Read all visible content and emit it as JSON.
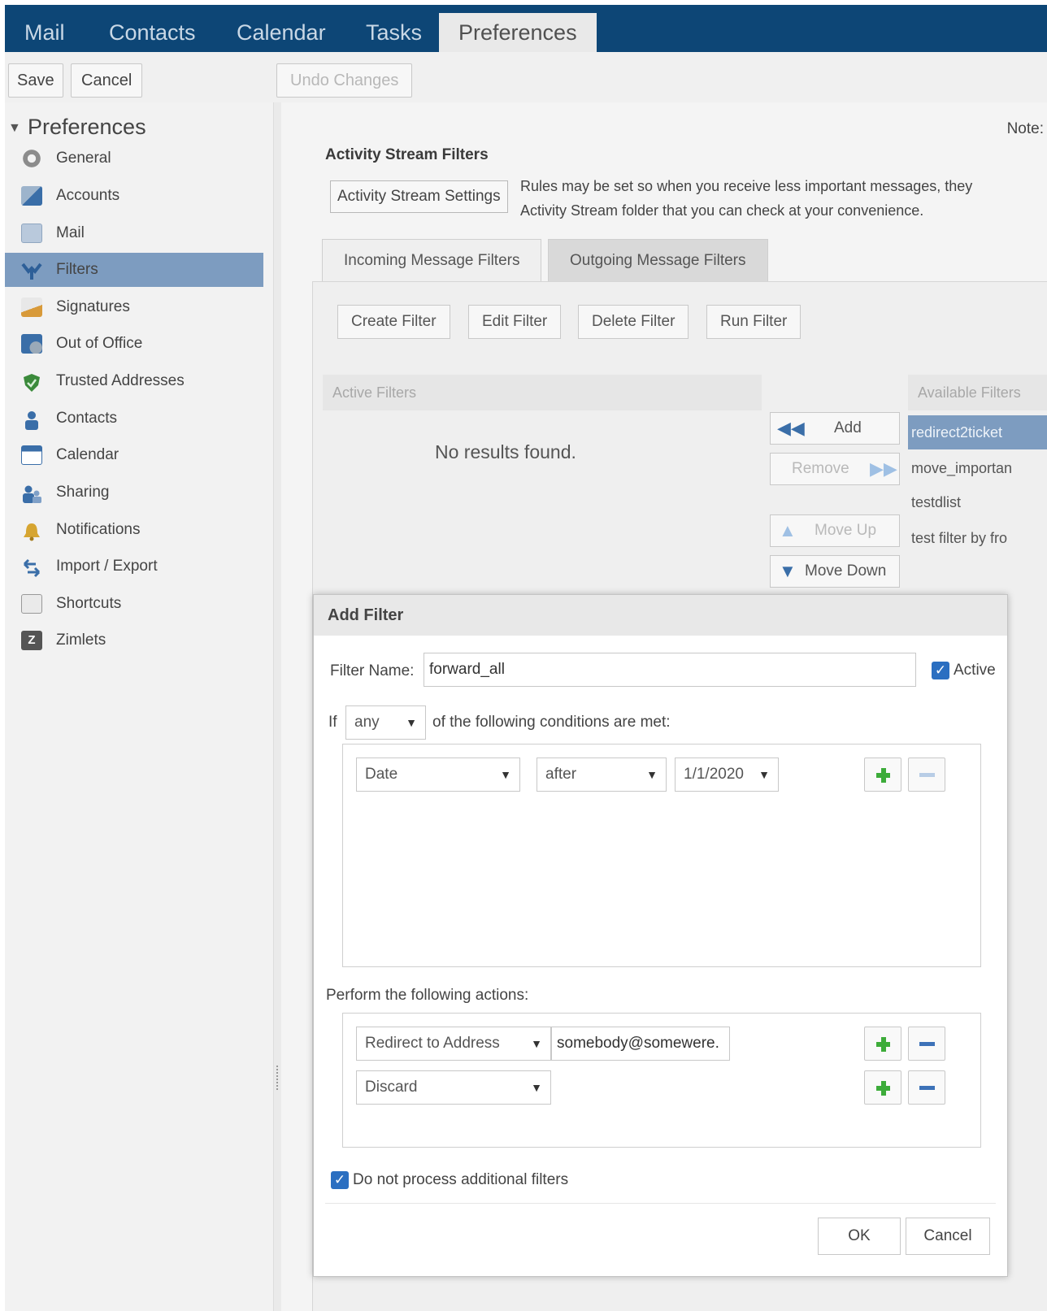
{
  "app_tabs": [
    "Mail",
    "Contacts",
    "Calendar",
    "Tasks",
    "Preferences"
  ],
  "toolbar": {
    "save": "Save",
    "cancel": "Cancel",
    "undo": "Undo Changes"
  },
  "sidebar": {
    "header": "Preferences",
    "items": [
      {
        "label": "General",
        "icon": "gear-icon"
      },
      {
        "label": "Accounts",
        "icon": "accounts-icon"
      },
      {
        "label": "Mail",
        "icon": "envelope-icon"
      },
      {
        "label": "Filters",
        "icon": "filter-icon"
      },
      {
        "label": "Signatures",
        "icon": "signature-icon"
      },
      {
        "label": "Out of Office",
        "icon": "out-of-office-icon"
      },
      {
        "label": "Trusted Addresses",
        "icon": "shield-icon"
      },
      {
        "label": "Contacts",
        "icon": "contacts-icon"
      },
      {
        "label": "Calendar",
        "icon": "calendar-icon"
      },
      {
        "label": "Sharing",
        "icon": "sharing-icon"
      },
      {
        "label": "Notifications",
        "icon": "bell-icon"
      },
      {
        "label": "Import / Export",
        "icon": "import-export-icon"
      },
      {
        "label": "Shortcuts",
        "icon": "keyboard-icon"
      },
      {
        "label": "Zimlets",
        "icon": "zimlet-icon"
      }
    ],
    "selected": "Filters"
  },
  "main": {
    "note": "Note:",
    "activity_stream": {
      "title": "Activity Stream Filters",
      "settings_button": "Activity Stream Settings",
      "description_line1": "Rules may be set so when you receive less important messages, they",
      "description_line2": "Activity Stream folder that you can check at your convenience."
    },
    "filter_tabs": [
      "Incoming Message Filters",
      "Outgoing Message Filters"
    ],
    "filter_buttons": [
      "Create Filter",
      "Edit Filter",
      "Delete Filter",
      "Run Filter"
    ],
    "active_filters_header": "Active Filters",
    "no_results": "No results found.",
    "move_buttons": {
      "add": "Add",
      "remove": "Remove",
      "move_up": "Move Up",
      "move_down": "Move Down"
    },
    "available_filters_header": "Available Filters",
    "available_filters": [
      "redirect2ticket",
      "move_importan",
      "testdlist",
      "test filter by fro"
    ]
  },
  "dialog": {
    "title": "Add Filter",
    "filter_name_label": "Filter Name:",
    "filter_name_value": "forward_all",
    "active_label": "Active",
    "if_label": "If",
    "match_value": "any",
    "conditions_label": "of the following conditions are met:",
    "condition": {
      "field": "Date",
      "op": "after",
      "value": "1/1/2020"
    },
    "actions_label": "Perform the following actions:",
    "actions": [
      {
        "action": "Redirect to Address",
        "value": "somebody@somewere."
      },
      {
        "action": "Discard"
      }
    ],
    "stop_label": "Do not process additional filters",
    "ok": "OK",
    "cancel": "Cancel"
  }
}
